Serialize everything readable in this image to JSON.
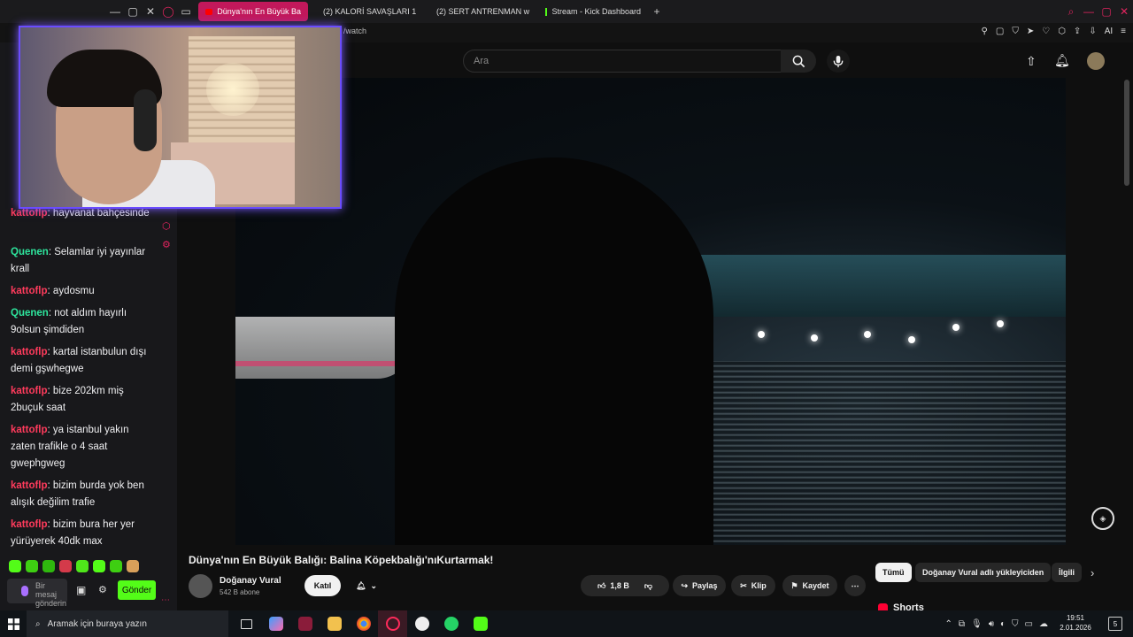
{
  "browser": {
    "tabs": [
      {
        "label": "Dünya'nın En Büyük Ba",
        "active": true,
        "icon": "youtube-icon"
      },
      {
        "label": "(2) KALORİ SAVAŞLARI 1",
        "active": false,
        "icon": "youtube-icon"
      },
      {
        "label": "(2) SERT ANTRENMAN w",
        "active": false,
        "icon": "youtube-icon"
      },
      {
        "label": "Stream - Kick Dashboard",
        "active": false,
        "icon": "kick-icon"
      }
    ],
    "new_tab": "+",
    "url_fragment": "/watch",
    "ai_label": "AI"
  },
  "youtube": {
    "search_placeholder": "Ara",
    "video": {
      "title": "Dünya'nın En Büyük Balığı: Balina Köpekbalığı'nıKurtarmak!",
      "channel": "Doğanay Vural",
      "subscribers": "542 B abone",
      "join": "Katıl",
      "likes": "1,8 B",
      "share": "Paylaş",
      "clip": "Klip",
      "save": "Kaydet"
    },
    "chips": [
      "Tümü",
      "Doğanay Vural adlı yükleyiciden",
      "İlgili"
    ],
    "shorts": "Shorts"
  },
  "chat": {
    "messages": [
      {
        "user": "kattoflp",
        "text": "hayvanat bahçesinde",
        "color": "#ff3b5c"
      },
      {
        "user": "Quenen",
        "text": "Selamlar iyi yayınlar krall",
        "color": "#2ee59d"
      },
      {
        "user": "kattoflp",
        "text": "aydosmu",
        "color": "#ff3b5c"
      },
      {
        "user": "Quenen",
        "text": "not aldım hayırlı 9olsun şimdiden",
        "color": "#2ee59d"
      },
      {
        "user": "kattoflp",
        "text": "kartal istanbulun dışı demi gşwhegwe",
        "color": "#ff3b5c"
      },
      {
        "user": "kattoflp",
        "text": "bize 202km miş 2buçuk saat",
        "color": "#ff3b5c"
      },
      {
        "user": "kattoflp",
        "text": "ya istanbul yakın zaten trafikle o 4 saat gwephgweg",
        "color": "#ff3b5c"
      },
      {
        "user": "kattoflp",
        "text": "bizim burda yok ben alışık değilim trafie",
        "color": "#ff3b5c"
      },
      {
        "user": "kattoflp",
        "text": "bizim bura her yer yürüyerek 40dk max",
        "color": "#ff3b5c"
      }
    ],
    "input_placeholder": "Bir mesaj gönderin",
    "send_label": "Gönder"
  },
  "taskbar": {
    "search_placeholder": "Aramak için buraya yazın",
    "time": "19:51",
    "date": "2.01.2026",
    "notification_count": "5"
  }
}
